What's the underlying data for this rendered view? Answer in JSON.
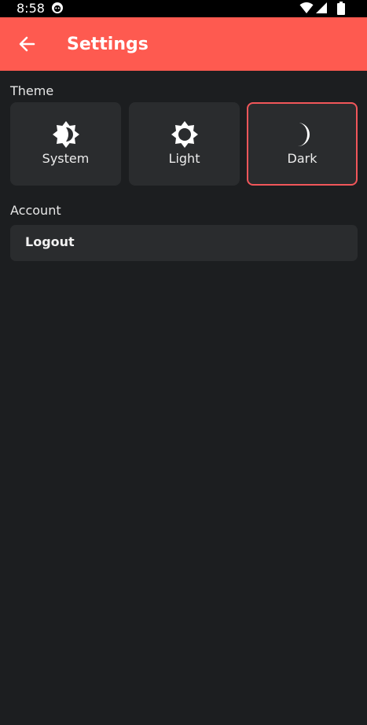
{
  "status_bar": {
    "time": "8:58",
    "app_icon": "notification-smiley-icon",
    "wifi_icon": "wifi-icon",
    "signal_icon": "cell-signal-icon",
    "battery_icon": "battery-icon"
  },
  "app_bar": {
    "back_icon": "arrow-back-icon",
    "title": "Settings",
    "color": "#fe5a50"
  },
  "theme": {
    "section_label": "Theme",
    "options": [
      {
        "label": "System",
        "icon": "brightness-auto-icon",
        "selected": false
      },
      {
        "label": "Light",
        "icon": "sun-icon",
        "selected": false
      },
      {
        "label": "Dark",
        "icon": "moon-icon",
        "selected": true
      }
    ],
    "selected_border_color": "#f1565a"
  },
  "account": {
    "section_label": "Account",
    "logout_label": "Logout"
  },
  "colors": {
    "background": "#1c1e20",
    "card": "#2a2c2e"
  }
}
